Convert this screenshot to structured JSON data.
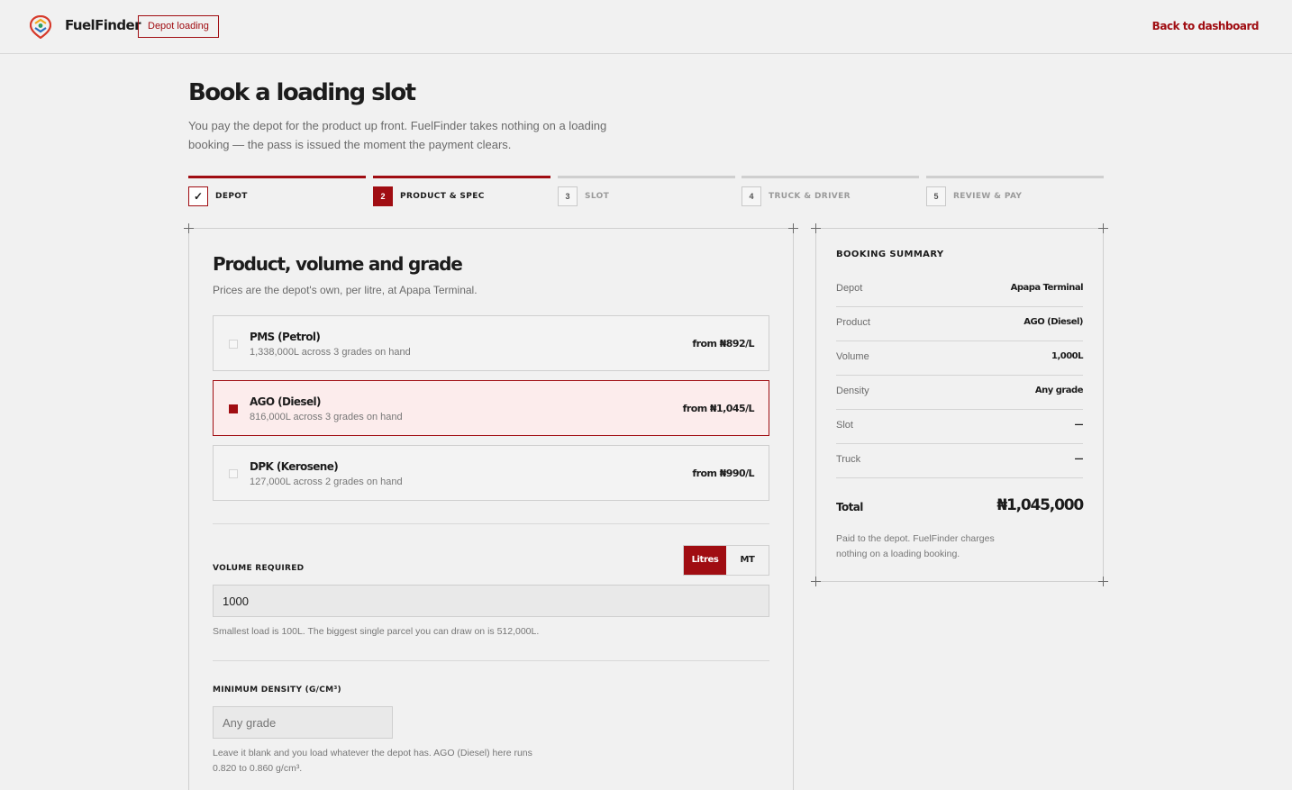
{
  "header": {
    "brand": "FuelFinder",
    "context_badge": "Depot loading",
    "back_link": "Back to dashboard"
  },
  "page": {
    "title": "Book a loading slot",
    "intro": "You pay the depot for the product up front. FuelFinder takes nothing on a loading booking — the pass is issued the moment the payment clears."
  },
  "steps": [
    {
      "num": "✓",
      "label": "Depot",
      "state": "done"
    },
    {
      "num": "2",
      "label": "Product & spec",
      "state": "active"
    },
    {
      "num": "3",
      "label": "Slot",
      "state": "pending"
    },
    {
      "num": "4",
      "label": "Truck & driver",
      "state": "pending"
    },
    {
      "num": "5",
      "label": "Review & pay",
      "state": "pending"
    }
  ],
  "form": {
    "title": "Product, volume and grade",
    "subtitle": "Prices are the depot's own, per litre, at Apapa Terminal.",
    "products": [
      {
        "name": "PMS (Petrol)",
        "stock": "1,338,000L across 3 grades on hand",
        "price": "from ₦892/L",
        "selected": false
      },
      {
        "name": "AGO (Diesel)",
        "stock": "816,000L across 3 grades on hand",
        "price": "from ₦1,045/L",
        "selected": true
      },
      {
        "name": "DPK (Kerosene)",
        "stock": "127,000L across 2 grades on hand",
        "price": "from ₦990/L",
        "selected": false
      }
    ],
    "volume": {
      "label": "Volume required",
      "units": [
        "Litres",
        "MT"
      ],
      "selected_unit": "Litres",
      "value": "1000",
      "hint": "Smallest load is 100L. The biggest single parcel you can draw on is 512,000L."
    },
    "density": {
      "label": "Minimum density (g/cm³)",
      "placeholder": "Any grade",
      "hint_line1": "Leave it blank and you load whatever the depot has. AGO (Diesel) here runs",
      "hint_line2": "0.820 to 0.860 g/cm³."
    }
  },
  "summary": {
    "title": "Booking summary",
    "rows": [
      {
        "key": "Depot",
        "value": "Apapa Terminal"
      },
      {
        "key": "Product",
        "value": "AGO (Diesel)"
      },
      {
        "key": "Volume",
        "value": "1,000L"
      },
      {
        "key": "Density",
        "value": "Any grade"
      },
      {
        "key": "Slot",
        "value": "—"
      },
      {
        "key": "Truck",
        "value": "—"
      }
    ],
    "total_label": "Total",
    "total_value": "₦1,045,000",
    "note": "Paid to the depot. FuelFinder charges nothing on a loading booking."
  },
  "colors": {
    "accent": "#a00d12",
    "background": "#f1f1f1"
  }
}
